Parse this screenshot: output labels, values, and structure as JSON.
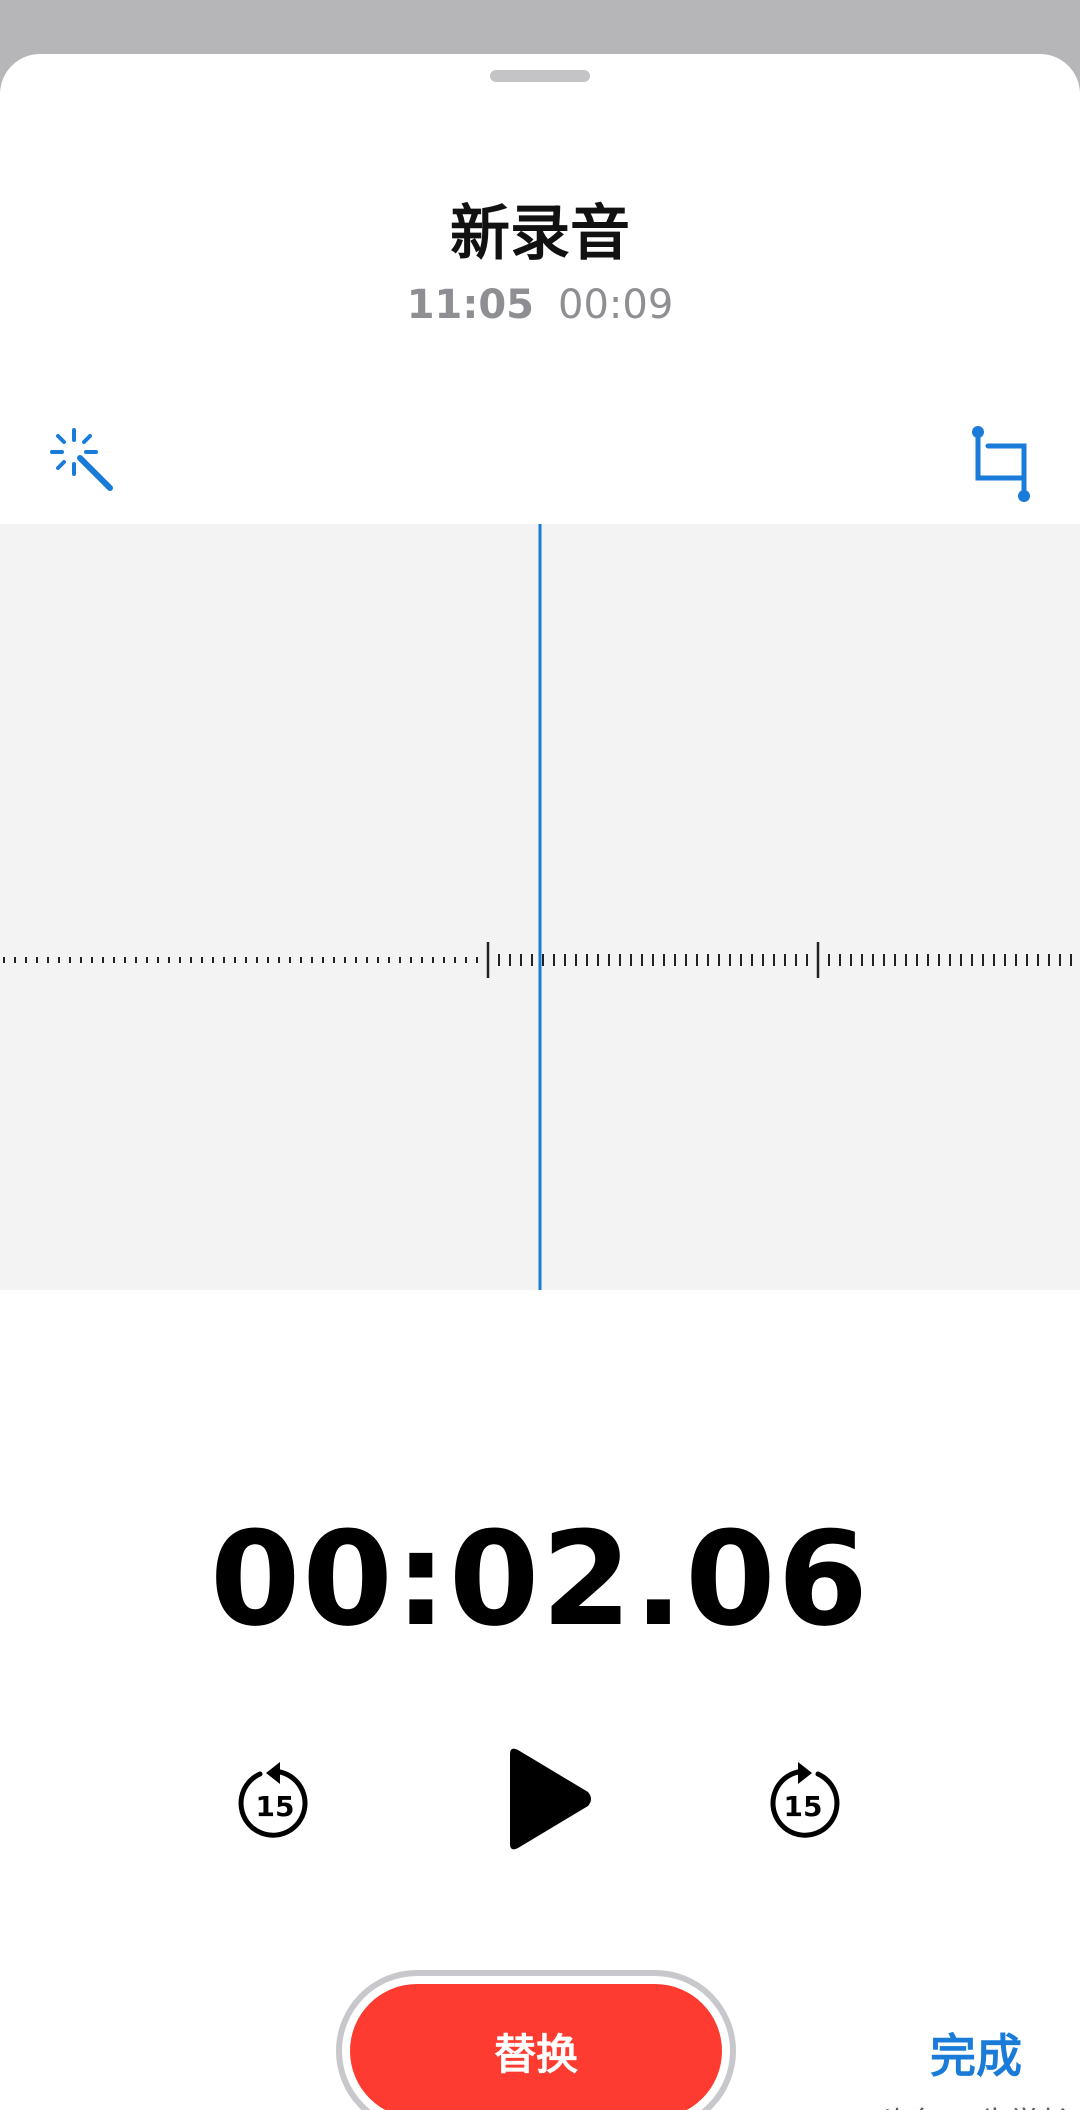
{
  "recording": {
    "title": "新录音",
    "time": "11:05",
    "duration": "00:09"
  },
  "player": {
    "elapsed": "00:02.06",
    "skip_back_seconds": "15",
    "skip_forward_seconds": "15"
  },
  "actions": {
    "replace_label": "替换",
    "done_label": "完成"
  },
  "watermark": {
    "text": "头条 @牛学长"
  },
  "icons": {
    "enhance": "magic-wand-icon",
    "trim": "crop-trim-icon",
    "skip_back": "gobackward-15-icon",
    "play": "play-icon",
    "skip_forward": "goforward-15-icon"
  },
  "colors": {
    "accent": "#1a7cd8",
    "playhead": "#1a7cd8",
    "record_red": "#fe3b30",
    "waveform_bg": "#f3f3f4",
    "sheet_bg": "#ffffff"
  }
}
